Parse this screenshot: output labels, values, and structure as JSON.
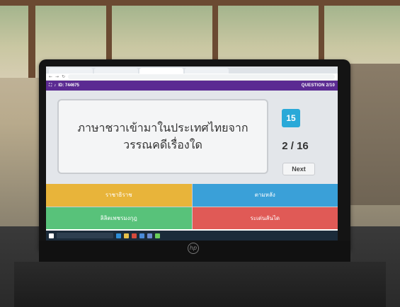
{
  "browser": {
    "tabs": [
      {
        "label": ""
      },
      {
        "label": ""
      },
      {
        "label": ""
      },
      {
        "label": ""
      }
    ],
    "url": ""
  },
  "game": {
    "room_id": "ID: 744675",
    "question_counter": "QUESTION 2/10",
    "question": "ภาษาชวาเข้ามาในประเทศไทยจาก วรรณคดีเรื่องใด",
    "timer": "15",
    "progress": "2 / 16",
    "next_label": "Next",
    "answers": [
      {
        "label": "ราชาธิราช",
        "color": "#e8b43a"
      },
      {
        "label": "ตามหลัง",
        "color": "#3aa0d8"
      },
      {
        "label": "ลิลิตเพชรมงกุฎ",
        "color": "#58c27a"
      },
      {
        "label": "ระเด่นลันได",
        "color": "#e05a56"
      }
    ]
  },
  "taskbar": {
    "search_placeholder": "",
    "tray_text": ""
  },
  "colors": {
    "header": "#5b2a92",
    "timer": "#2aa9d8"
  }
}
